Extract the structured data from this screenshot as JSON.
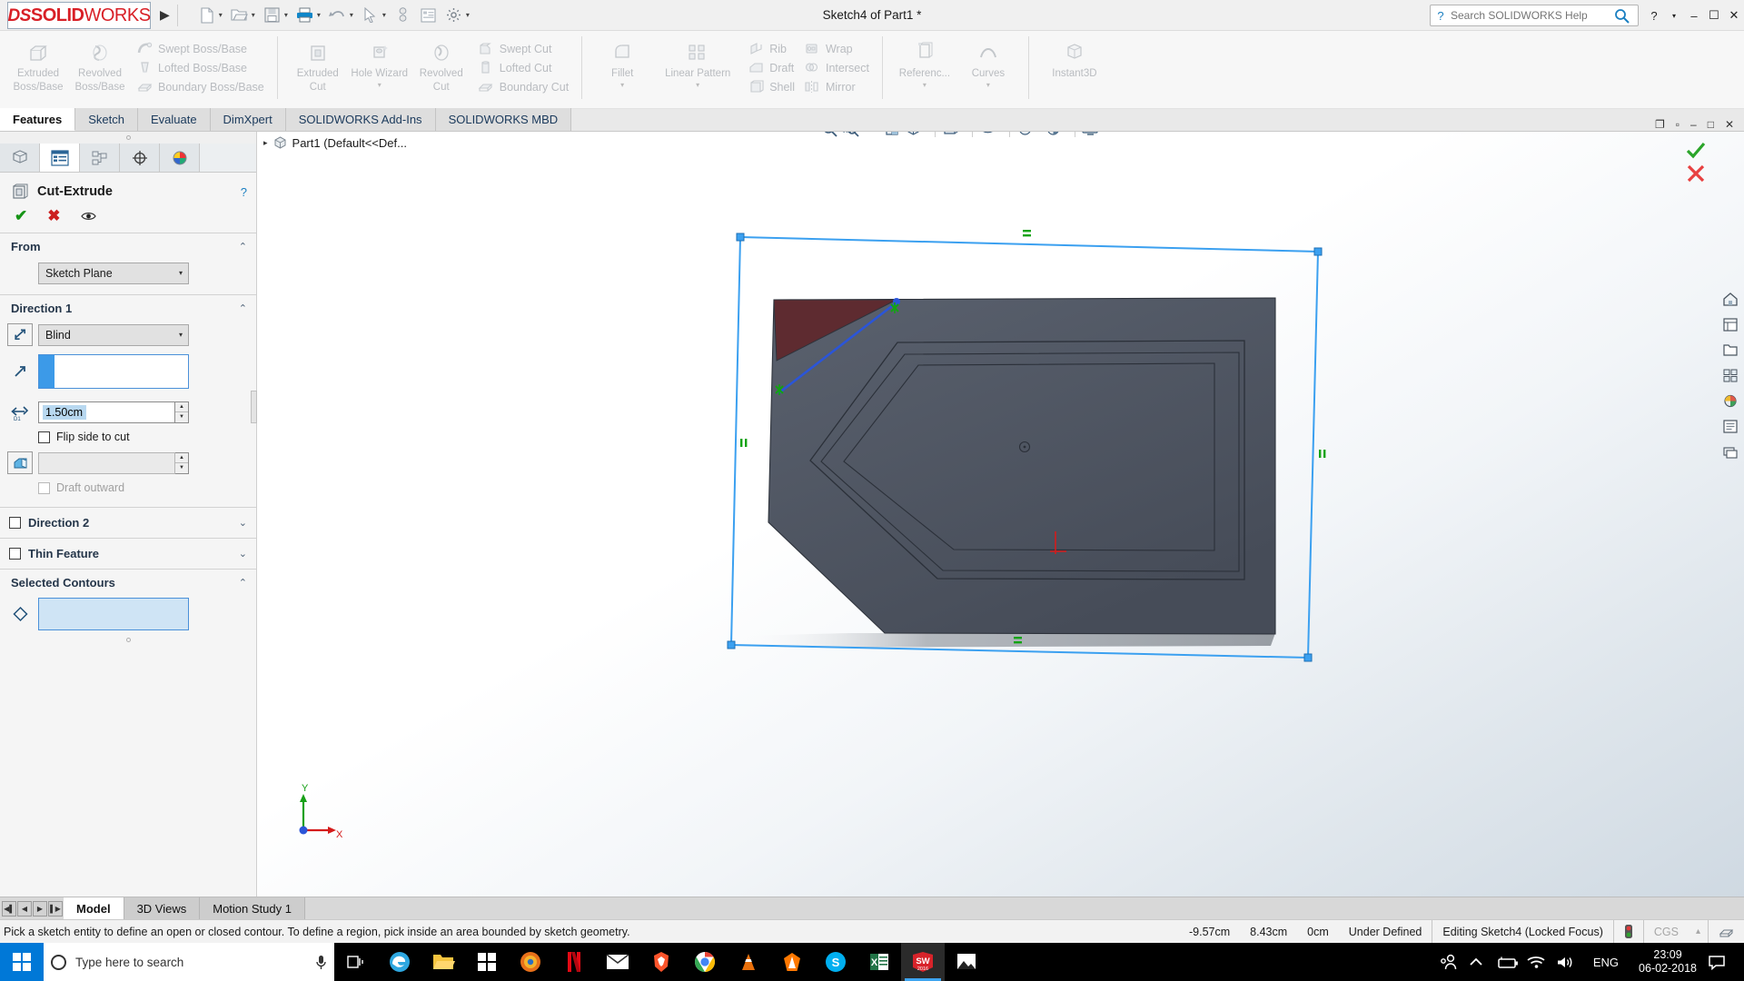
{
  "titlebar": {
    "logo_ds": "DS",
    "logo_solid": "SOLID",
    "logo_works": "WORKS",
    "document_title": "Sketch4 of Part1 *",
    "quick_access": [
      {
        "name": "new-document",
        "glyph": "⬜"
      },
      {
        "name": "open-document",
        "glyph": "📂"
      },
      {
        "name": "save-document",
        "glyph": "💾"
      },
      {
        "name": "print-document",
        "glyph": "🖨"
      },
      {
        "name": "undo",
        "glyph": "↶"
      },
      {
        "name": "select-pointer",
        "glyph": "↖"
      },
      {
        "name": "rebuild",
        "glyph": "⚡"
      },
      {
        "name": "file-properties",
        "glyph": "☷"
      },
      {
        "name": "options",
        "glyph": "⚙"
      }
    ],
    "help_placeholder": "Search SOLIDWORKS Help",
    "help_question": "?",
    "window_buttons": {
      "help": "?",
      "help_caret": "▾",
      "minimize": "–",
      "maximize": "☐",
      "close": "✕"
    }
  },
  "ribbon": {
    "groups": [
      {
        "name": "boss-base",
        "big": [
          {
            "label": "Extruded\nBoss/Base",
            "label1": "Extruded",
            "label2": "Boss/Base",
            "icon": "extruded-boss-icon"
          },
          {
            "label": "Revolved\nBoss/Base",
            "label1": "Revolved",
            "label2": "Boss/Base",
            "icon": "revolved-boss-icon"
          }
        ],
        "small": [
          {
            "label": "Swept Boss/Base",
            "icon": "swept-boss-icon"
          },
          {
            "label": "Lofted Boss/Base",
            "icon": "lofted-boss-icon"
          },
          {
            "label": "Boundary Boss/Base",
            "icon": "boundary-boss-icon"
          }
        ]
      },
      {
        "name": "cut",
        "big": [
          {
            "label1": "Extruded",
            "label2": "Cut",
            "icon": "extruded-cut-icon",
            "caret": true
          },
          {
            "label1": "Hole Wizard",
            "label2": "",
            "icon": "hole-wizard-icon",
            "caret": true
          },
          {
            "label1": "Revolved",
            "label2": "Cut",
            "icon": "revolved-cut-icon"
          }
        ],
        "small": [
          {
            "label": "Swept Cut",
            "icon": "swept-cut-icon"
          },
          {
            "label": "Lofted Cut",
            "icon": "lofted-cut-icon"
          },
          {
            "label": "Boundary Cut",
            "icon": "boundary-cut-icon"
          }
        ]
      },
      {
        "name": "features",
        "big": [
          {
            "label1": "Fillet",
            "label2": "",
            "icon": "fillet-icon",
            "caret": true
          },
          {
            "label1": "Linear Pattern",
            "label2": "",
            "icon": "linear-pattern-icon",
            "caret": true
          }
        ],
        "small": [
          {
            "label": "Rib",
            "icon": "rib-icon"
          },
          {
            "label": "Draft",
            "icon": "draft-icon"
          },
          {
            "label": "Shell",
            "icon": "shell-icon"
          }
        ],
        "small2": [
          {
            "label": "Wrap",
            "icon": "wrap-icon"
          },
          {
            "label": "Intersect",
            "icon": "intersect-icon"
          },
          {
            "label": "Mirror",
            "icon": "mirror-icon"
          }
        ]
      },
      {
        "name": "reference",
        "big": [
          {
            "label1": "Referenc...",
            "label2": "",
            "icon": "reference-geometry-icon",
            "caret": true
          },
          {
            "label1": "Curves",
            "label2": "",
            "icon": "curves-icon",
            "caret": true
          }
        ]
      },
      {
        "name": "instant3d",
        "big": [
          {
            "label1": "Instant3D",
            "label2": "",
            "icon": "instant3d-icon"
          }
        ]
      }
    ]
  },
  "ribbon_tabs": {
    "items": [
      {
        "label": "Features",
        "active": true
      },
      {
        "label": "Sketch",
        "active": false
      },
      {
        "label": "Evaluate",
        "active": false
      },
      {
        "label": "DimXpert",
        "active": false
      },
      {
        "label": "SOLIDWORKS Add-Ins",
        "active": false
      },
      {
        "label": "SOLIDWORKS MBD",
        "active": false
      }
    ],
    "right_buttons": [
      {
        "name": "pin-ribbon",
        "glyph": "❐"
      },
      {
        "name": "restore-window",
        "glyph": "▫"
      },
      {
        "name": "minimize-window",
        "glyph": "–"
      },
      {
        "name": "maximize-window",
        "glyph": "□"
      },
      {
        "name": "close-window",
        "glyph": "✕"
      }
    ]
  },
  "view_toolbar": {
    "items": [
      {
        "name": "zoom-to-fit-icon",
        "glyph": "🔍"
      },
      {
        "name": "zoom-to-area-icon",
        "glyph": "🔎"
      },
      {
        "name": "previous-view-icon",
        "glyph": "↺"
      },
      {
        "name": "section-view-icon",
        "glyph": "▧"
      },
      {
        "name": "view-orientation-icon",
        "glyph": "▦",
        "caret": true
      },
      {
        "name": "display-style-icon",
        "glyph": "◰",
        "caret": true
      },
      {
        "name": "hide-show-items-icon",
        "glyph": "👁",
        "caret": true
      },
      {
        "name": "edit-appearance-icon",
        "glyph": "●",
        "caret": true
      },
      {
        "name": "apply-scene-icon",
        "glyph": "◑",
        "caret": true
      },
      {
        "name": "view-settings-icon",
        "glyph": "🖥",
        "caret": true
      }
    ]
  },
  "property_manager": {
    "tabs": [
      {
        "name": "feature-manager-tab",
        "label": "FeatureManager",
        "active": false
      },
      {
        "name": "property-manager-tab",
        "label": "PropertyManager",
        "active": true
      },
      {
        "name": "configuration-manager-tab",
        "label": "ConfigurationManager",
        "active": false
      },
      {
        "name": "dimxpert-manager-tab",
        "label": "DimXpertManager",
        "active": false
      },
      {
        "name": "display-manager-tab",
        "label": "DisplayManager",
        "active": false
      }
    ],
    "title": "Cut-Extrude",
    "help_glyph": "?",
    "actions": {
      "ok": "✔",
      "cancel": "✖",
      "preview": "◉"
    },
    "sections": {
      "from": {
        "title": "From",
        "collapse": "⌃",
        "value": "Sketch Plane",
        "dropdown_caret": "▾"
      },
      "direction1": {
        "title": "Direction 1",
        "collapse": "⌃",
        "end_condition": "Blind",
        "dropdown_caret": "▾",
        "depth_value": "1.50cm",
        "flip_side_label": "Flip side to cut",
        "flip_side_checked": false,
        "draft_outward_label": "Draft outward",
        "draft_outward_checked": false,
        "draft_outward_disabled": true
      },
      "direction2": {
        "title": "Direction 2",
        "collapse": "⌄",
        "checked": false
      },
      "thin_feature": {
        "title": "Thin Feature",
        "collapse": "⌄",
        "checked": false
      },
      "selected_contours": {
        "title": "Selected Contours",
        "collapse": "⌃"
      }
    }
  },
  "feature_tree": {
    "caret": "▸",
    "root_label": "Part1  (Default<<Def..."
  },
  "graphics": {
    "confirm_ok": "✔",
    "confirm_cancel": "✖",
    "task_pane": [
      {
        "name": "home-icon",
        "glyph": "⌂"
      },
      {
        "name": "design-library-icon",
        "glyph": "▤"
      },
      {
        "name": "file-explorer-icon",
        "glyph": "🗁"
      },
      {
        "name": "view-palette-icon",
        "glyph": "▦"
      },
      {
        "name": "appearances-scenes-icon",
        "glyph": "◕"
      },
      {
        "name": "custom-properties-icon",
        "glyph": "☰"
      },
      {
        "name": "solidworks-forum-icon",
        "glyph": "⧉"
      }
    ],
    "triad": {
      "x_label": "X",
      "y_label": "Y"
    }
  },
  "bottom_tabs": {
    "nav": [
      {
        "name": "first-tab-button",
        "glyph": "◀▏"
      },
      {
        "name": "previous-tab-button",
        "glyph": "◀"
      },
      {
        "name": "next-tab-button",
        "glyph": "▶"
      },
      {
        "name": "last-tab-button",
        "glyph": "▏▶"
      }
    ],
    "tabs": [
      {
        "label": "Model",
        "active": true
      },
      {
        "label": "3D Views",
        "active": false
      },
      {
        "label": "Motion Study 1",
        "active": false
      }
    ]
  },
  "status_bar": {
    "message": "Pick a sketch entity to define an open or closed contour. To define a region, pick inside an area bounded by sketch geometry.",
    "coord_x": "-9.57cm",
    "coord_y": "8.43cm",
    "coord_z": "0cm",
    "definition_state": "Under Defined",
    "edit_state": "Editing Sketch4 (Locked Focus)",
    "traffic_icon": "🚦",
    "units": "CGS",
    "units_caret": "▴",
    "overlay_icon": "⬚"
  },
  "taskbar": {
    "search_placeholder": "Type here to search",
    "mic_glyph": "🎤",
    "task_view_glyph": "❐",
    "apps": [
      {
        "name": "edge-app",
        "glyph": "e",
        "color": "#2ea7e0",
        "active": false
      },
      {
        "name": "file-explorer-app",
        "glyph": "📁",
        "color": "#f5c43f",
        "active": false
      },
      {
        "name": "microsoft-store-app",
        "glyph": "⊞",
        "color": "#ffffff",
        "active": false
      },
      {
        "name": "firefox-app",
        "glyph": "●",
        "color": "#e8701a",
        "active": false
      },
      {
        "name": "netflix-app",
        "glyph": "N",
        "color": "#e50914",
        "active": false
      },
      {
        "name": "mail-app",
        "glyph": "✉",
        "color": "#ffffff",
        "active": false
      },
      {
        "name": "brave-app",
        "glyph": "▲",
        "color": "#fb542b",
        "active": false
      },
      {
        "name": "chrome-app",
        "glyph": "◉",
        "color": "#4285f4",
        "active": false
      },
      {
        "name": "vlc-app",
        "glyph": "△",
        "color": "#d9d9d9",
        "active": false
      },
      {
        "name": "avast-app",
        "glyph": "▲",
        "color": "#ff7800",
        "active": false
      },
      {
        "name": "skype-app",
        "glyph": "S",
        "color": "#00aff0",
        "active": false
      },
      {
        "name": "excel-app",
        "glyph": "X",
        "color": "#217346",
        "active": false
      },
      {
        "name": "solidworks-app",
        "glyph": "SW",
        "sub": "2016",
        "color": "#d8232a",
        "active": true
      },
      {
        "name": "photos-app",
        "glyph": "🏔",
        "color": "#ffffff",
        "active": false
      }
    ],
    "tray": [
      {
        "name": "people-icon",
        "glyph": "☺"
      },
      {
        "name": "show-hidden-icons-icon",
        "glyph": "⌃"
      },
      {
        "name": "battery-icon",
        "glyph": "▭"
      },
      {
        "name": "wifi-icon",
        "glyph": "◠"
      },
      {
        "name": "volume-icon",
        "glyph": "🔊"
      }
    ],
    "language": "ENG",
    "time": "23:09",
    "date": "06-02-2018",
    "notification_glyph": "▭"
  },
  "colors": {
    "brand_red": "#d81f26",
    "accent_blue": "#3c9ae8",
    "sketch_blue": "#3ba0f0",
    "model_gray": "#4b5260",
    "highlight_maroon": "#5e2b30",
    "relation_green": "#13a313",
    "taskbar_black": "#000000",
    "start_blue": "#0078d7"
  }
}
